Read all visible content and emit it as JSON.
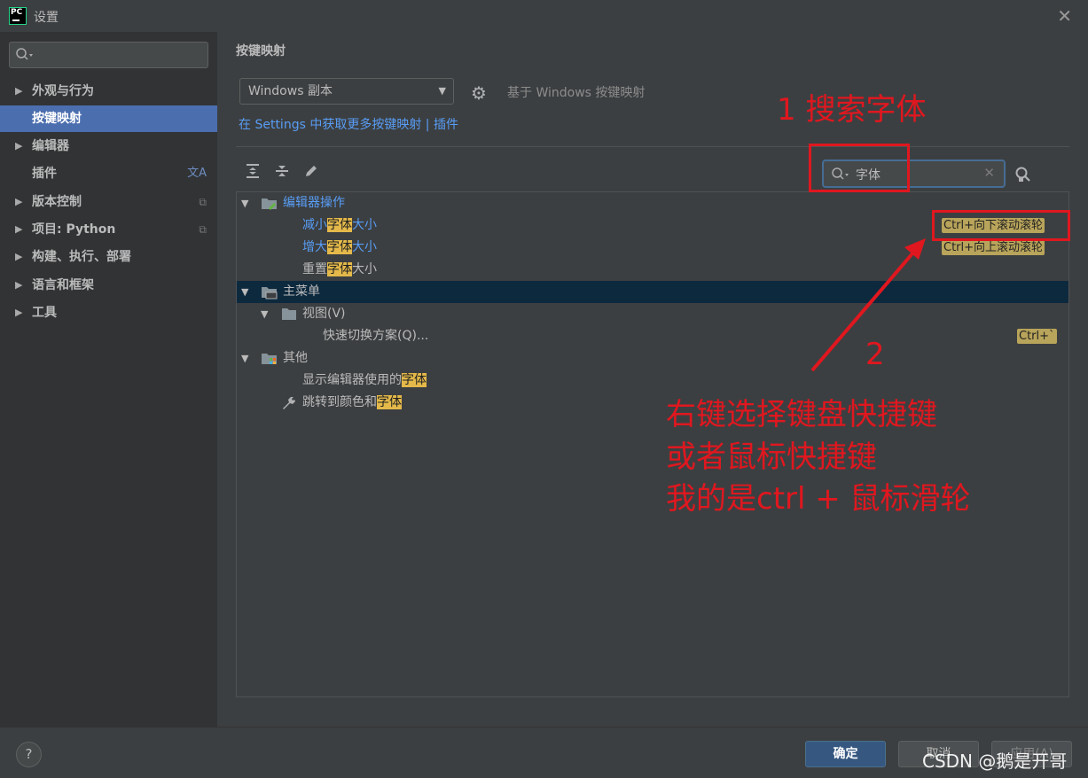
{
  "window": {
    "title": "设置",
    "logo_text": "PC"
  },
  "sidebar": {
    "search_placeholder": "",
    "items": [
      {
        "label": "外观与行为",
        "expandable": true
      },
      {
        "label": "按键映射",
        "expandable": false,
        "active": true
      },
      {
        "label": "编辑器",
        "expandable": true
      },
      {
        "label": "插件",
        "expandable": false
      },
      {
        "label": "版本控制",
        "expandable": true
      },
      {
        "label": "项目: Python",
        "expandable": true
      },
      {
        "label": "构建、执行、部署",
        "expandable": true
      },
      {
        "label": "语言和框架",
        "expandable": true
      },
      {
        "label": "工具",
        "expandable": true
      }
    ]
  },
  "main": {
    "section_title": "按键映射",
    "keymap_select": "Windows 副本",
    "based_on": "基于 Windows 按键映射",
    "settings_link": "在 Settings 中获取更多按键映射 | 插件",
    "search_value": "字体"
  },
  "tree": {
    "editor_actions": "编辑器操作",
    "row1": {
      "pre": "减小",
      "hl": "字体",
      "post": "大小",
      "shortcut": "Ctrl+向下滚动滚轮"
    },
    "row2": {
      "pre": "增大",
      "hl": "字体",
      "post": "大小",
      "shortcut": "Ctrl+向上滚动滚轮"
    },
    "row3": {
      "pre": "重置",
      "hl": "字体",
      "post": "大小"
    },
    "main_menu": "主菜单",
    "view_menu": "视图(V)",
    "quick_switch": "快速切换方案(Q)...",
    "quick_switch_shortcut": "Ctrl+`",
    "other": "其他",
    "row_show": {
      "pre": "显示编辑器使用的",
      "hl": "字体"
    },
    "row_jump": {
      "pre": "跳转到颜色和",
      "hl": "字体"
    }
  },
  "annotations": {
    "step1": "1   搜索字体",
    "step2": "2",
    "note_line1": "右键选择键盘快捷键",
    "note_line2": "或者鼠标快捷键",
    "note_line3": "我的是ctrl + 鼠标滑轮",
    "color": "#e0171f"
  },
  "footer": {
    "help": "?",
    "ok": "确定",
    "cancel": "取消",
    "apply": "应用(A)",
    "watermark": "CSDN @鹅是开哥"
  }
}
